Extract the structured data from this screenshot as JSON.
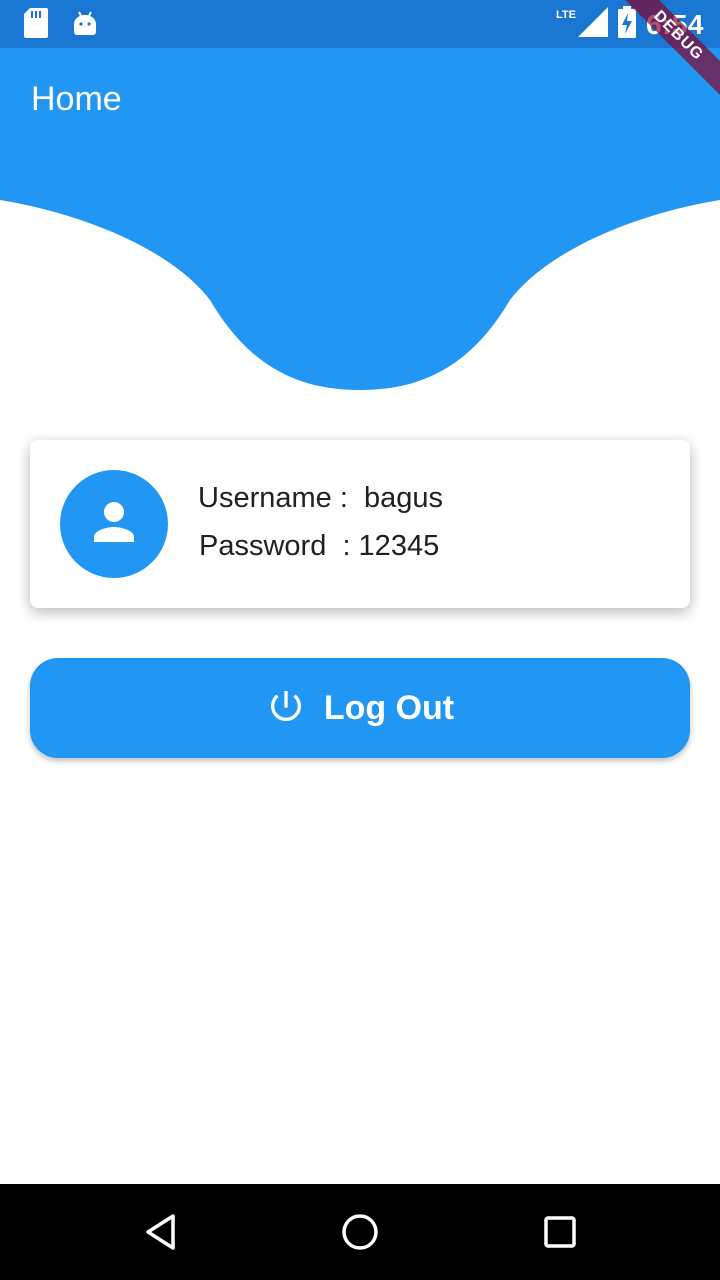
{
  "status_bar": {
    "time": "6:54",
    "network": "LTE",
    "icons": [
      "sd-card-icon",
      "android-icon",
      "signal-icon",
      "battery-charging-icon"
    ]
  },
  "debug_banner": "DEBUG",
  "appbar": {
    "title": "Home"
  },
  "profile": {
    "username_line": "Username :  bagus",
    "password_line": "Password  : 12345",
    "avatar_icon": "person-icon"
  },
  "logout": {
    "label": "Log Out",
    "icon": "power-icon"
  },
  "nav": {
    "icons": [
      "back-icon",
      "home-icon",
      "recents-icon"
    ]
  },
  "colors": {
    "primary": "#2196F3",
    "status_bar": "#1976D2",
    "nav_bar": "#000000"
  }
}
